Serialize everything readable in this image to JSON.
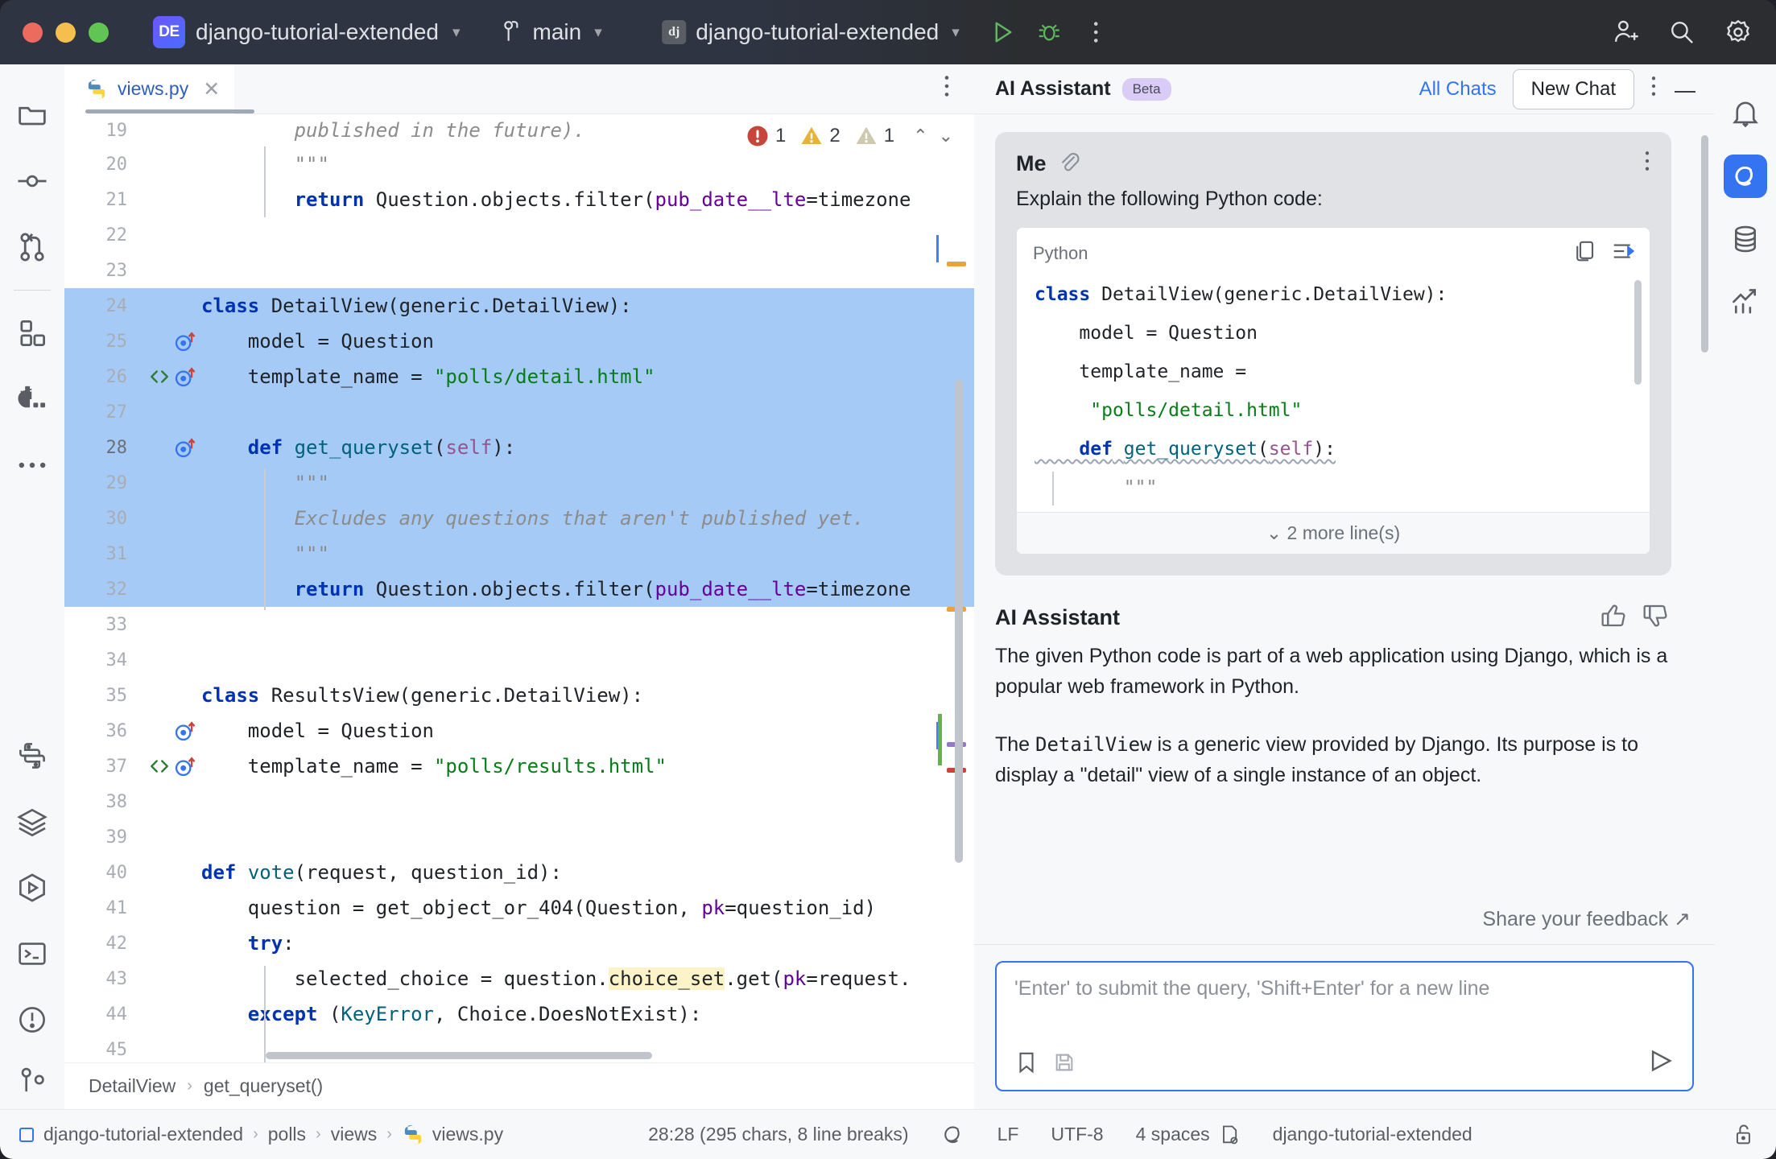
{
  "titlebar": {
    "project_badge": "DE",
    "project_name": "django-tutorial-extended",
    "branch": "main",
    "run_config_badge": "dj",
    "run_config_name": "django-tutorial-extended"
  },
  "left_rail": {
    "items": [
      {
        "name": "project-icon",
        "label": "Project"
      },
      {
        "name": "commit-icon",
        "label": "Commit"
      },
      {
        "name": "pull-requests-icon",
        "label": "Pull Requests"
      },
      {
        "name": "structure-icon",
        "label": "Structure"
      },
      {
        "name": "django-icon",
        "label": "Django"
      },
      {
        "name": "more-tool-windows-icon",
        "label": "More Tool Windows"
      }
    ],
    "bottom_items": [
      {
        "name": "python-packages-icon",
        "label": "Python Packages"
      },
      {
        "name": "python-console-icon",
        "label": "Python Console"
      },
      {
        "name": "run-icon",
        "label": "Run"
      },
      {
        "name": "terminal-icon",
        "label": "Terminal"
      },
      {
        "name": "problems-icon",
        "label": "Problems"
      },
      {
        "name": "version-control-icon",
        "label": "Version Control"
      }
    ]
  },
  "right_rail": {
    "items": [
      {
        "name": "notifications-icon",
        "label": "Notifications"
      },
      {
        "name": "ai-assistant-icon",
        "label": "AI Assistant"
      },
      {
        "name": "database-icon",
        "label": "Database"
      },
      {
        "name": "profiler-icon",
        "label": "Profiler"
      }
    ]
  },
  "editor": {
    "tab_name": "views.py",
    "inspections": {
      "errors": "1",
      "warnings": "2",
      "weak_warnings": "1"
    },
    "breadcrumb": [
      "DetailView",
      "get_queryset()"
    ],
    "lines": [
      {
        "n": "19",
        "text": "        published in the future)."
      },
      {
        "n": "20",
        "text": "        \"\"\""
      },
      {
        "n": "21",
        "text": "        return Question.objects.filter(pub_date__lte=timezone"
      },
      {
        "n": "22",
        "text": ""
      },
      {
        "n": "23",
        "text": ""
      },
      {
        "n": "24",
        "text": "class DetailView(generic.DetailView):"
      },
      {
        "n": "25",
        "text": "    model = Question"
      },
      {
        "n": "26",
        "text": "    template_name = \"polls/detail.html\""
      },
      {
        "n": "27",
        "text": ""
      },
      {
        "n": "28",
        "text": "    def get_queryset(self):"
      },
      {
        "n": "29",
        "text": "        \"\"\""
      },
      {
        "n": "30",
        "text": "        Excludes any questions that aren't published yet."
      },
      {
        "n": "31",
        "text": "        \"\"\""
      },
      {
        "n": "32",
        "text": "        return Question.objects.filter(pub_date__lte=timezone"
      },
      {
        "n": "33",
        "text": ""
      },
      {
        "n": "34",
        "text": ""
      },
      {
        "n": "35",
        "text": "class ResultsView(generic.DetailView):"
      },
      {
        "n": "36",
        "text": "    model = Question"
      },
      {
        "n": "37",
        "text": "    template_name = \"polls/results.html\""
      },
      {
        "n": "38",
        "text": ""
      },
      {
        "n": "39",
        "text": ""
      },
      {
        "n": "40",
        "text": "def vote(request, question_id):"
      },
      {
        "n": "41",
        "text": "    question = get_object_or_404(Question, pk=question_id)"
      },
      {
        "n": "42",
        "text": "    try:"
      },
      {
        "n": "43",
        "text": "        selected_choice = question.choice_set.get(pk=request."
      },
      {
        "n": "44",
        "text": "    except (KeyError, Choice.DoesNotExist):"
      },
      {
        "n": "45",
        "text": ""
      }
    ]
  },
  "ai_panel": {
    "title": "AI Assistant",
    "badge": "Beta",
    "all_chats": "All Chats",
    "new_chat": "New Chat",
    "user_message": {
      "author": "Me",
      "text": "Explain the following Python code:",
      "code_lang": "Python",
      "code_lines": [
        "class DetailView(generic.DetailView):",
        "    model = Question",
        "    template_name =",
        "     \"polls/detail.html\"",
        "    def get_queryset(self):",
        "        \"\"\""
      ],
      "more_lines": "2 more line(s)"
    },
    "assistant_message": {
      "author": "AI Assistant",
      "paragraph1": "The given Python code is part of a web application using Django, which is a popular web framework in Python.",
      "paragraph2_pre": "The ",
      "paragraph2_code": "DetailView",
      "paragraph2_post": " is a generic view provided by Django. Its purpose is to display a \"detail\" view of a single instance of an object."
    },
    "feedback": "Share your feedback",
    "composer_placeholder": "'Enter' to submit the query, 'Shift+Enter' for a new line"
  },
  "statusbar": {
    "breadcrumb": [
      "django-tutorial-extended",
      "polls",
      "views",
      "views.py"
    ],
    "caret": "28:28 (295 chars, 8 line breaks)",
    "line_separator": "LF",
    "encoding": "UTF-8",
    "indent": "4 spaces",
    "interpreter": "django-tutorial-extended"
  },
  "colors": {
    "accent": "#3574f0",
    "selection": "#a6caf6",
    "error": "#c9453a",
    "warning": "#e8b339",
    "weak_warning": "#cfc9b0",
    "keyword": "#0033b3",
    "string": "#067d17"
  }
}
